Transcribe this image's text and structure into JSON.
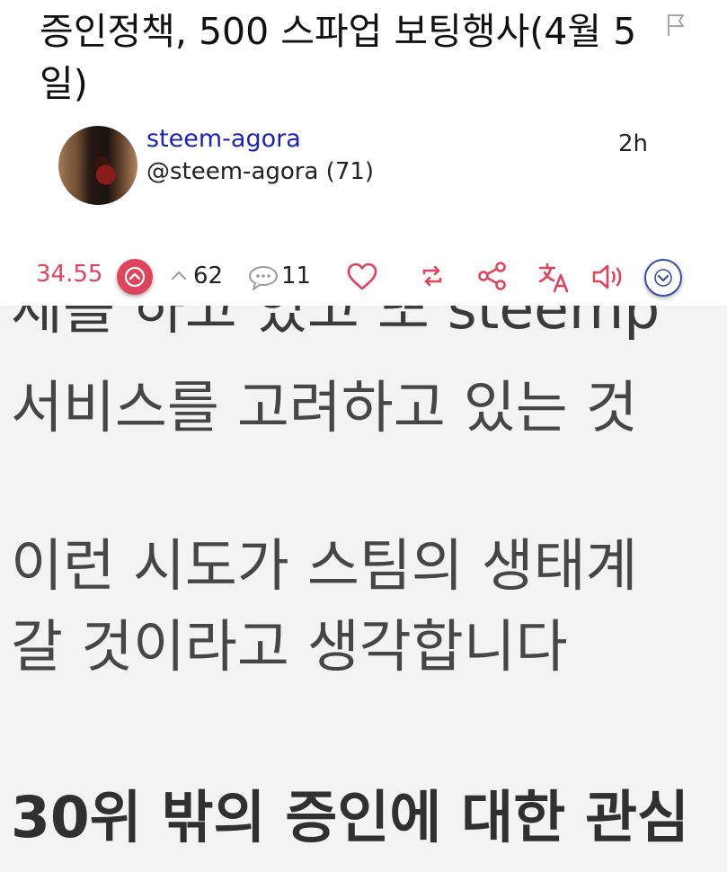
{
  "post": {
    "title": "증인정책, 500 스파업 보팅행사(4월 5일)",
    "author_name": "steem-agora",
    "author_handle": "@steem-agora (71)",
    "time": "2h"
  },
  "actions": {
    "payout": "34.55",
    "votes": "62",
    "comments": "11"
  },
  "body": {
    "cut_line": "제를 하고 있고 또 steemp",
    "line1": "서비스를 고려하고 있는 것",
    "line2": "이런 시도가 스팀의 생태계",
    "line3": "갈 것이라고 생각합니다",
    "heading": "30위 밖의 증인에 대한 관심"
  },
  "colors": {
    "accent": "#e0445c",
    "link": "#1a22b8",
    "more_ring": "#3b4fa8",
    "text": "#464646"
  },
  "icons": [
    "flag-icon",
    "upvote-icon",
    "chevron-up-icon",
    "comment-icon",
    "heart-icon",
    "resteem-icon",
    "share-icon",
    "translate-icon",
    "speaker-icon",
    "chevron-down-icon"
  ]
}
